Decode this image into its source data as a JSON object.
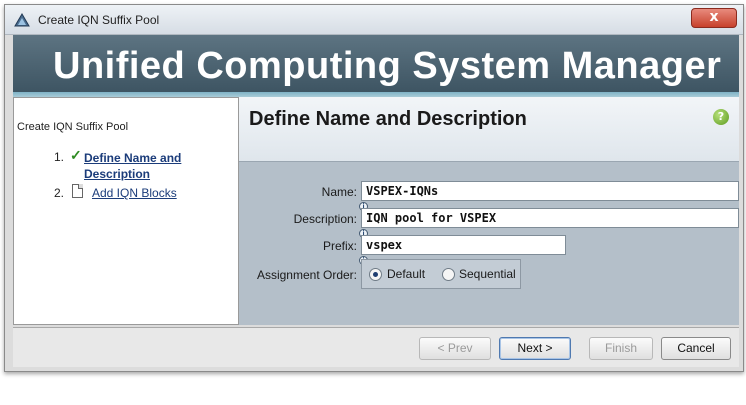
{
  "window": {
    "title": "Create IQN Suffix Pool",
    "close_symbol": "x"
  },
  "banner": {
    "title": "Unified Computing System Manager"
  },
  "wizard": {
    "title": "Create IQN Suffix Pool",
    "steps": [
      {
        "number": "1.",
        "label": "Define Name and Description",
        "status": "current",
        "icon": "check-icon"
      },
      {
        "number": "2.",
        "label": "Add IQN Blocks",
        "status": "pending",
        "icon": "document-icon"
      }
    ]
  },
  "section": {
    "title": "Define Name and Description",
    "help_symbol": "?"
  },
  "form": {
    "name_label": "Name:",
    "name_value": "VSPEX-IQNs",
    "description_label": "Description:",
    "description_value": "IQN pool for VSPEX",
    "prefix_label": "Prefix:",
    "prefix_value": "vspex",
    "assignment_label": "Assignment Order:",
    "assignment_options": [
      {
        "label": "Default",
        "selected": true
      },
      {
        "label": "Sequential",
        "selected": false
      }
    ],
    "info_symbol": "i"
  },
  "footer": {
    "prev_label": "< Prev",
    "next_label": "Next >",
    "finish_label": "Finish",
    "cancel_label": "Cancel"
  },
  "colors": {
    "banner": "#3b5260",
    "link": "#1b3c7a",
    "check": "#2e8b22"
  }
}
